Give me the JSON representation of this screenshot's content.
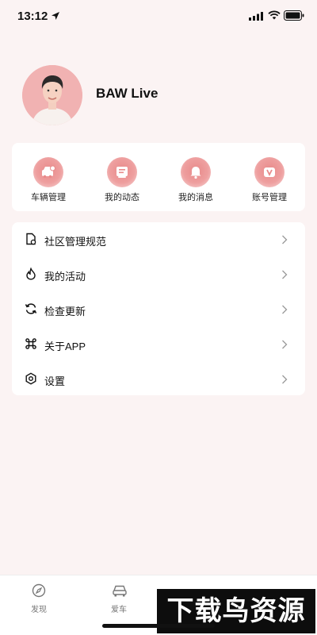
{
  "status_bar": {
    "time": "13:12"
  },
  "profile": {
    "username": "BAW Live"
  },
  "quick_actions": [
    {
      "label": "车辆管理",
      "icon": "car-manage-icon"
    },
    {
      "label": "我的动态",
      "icon": "feed-icon"
    },
    {
      "label": "我的消息",
      "icon": "bell-icon"
    },
    {
      "label": "账号管理",
      "icon": "account-icon"
    }
  ],
  "menu": [
    {
      "label": "社区管理规范",
      "icon": "document-icon"
    },
    {
      "label": "我的活动",
      "icon": "flame-icon"
    },
    {
      "label": "检查更新",
      "icon": "refresh-icon"
    },
    {
      "label": "关于APP",
      "icon": "command-icon"
    },
    {
      "label": "设置",
      "icon": "settings-icon"
    }
  ],
  "tabs": [
    {
      "label": "发现",
      "icon": "compass-icon"
    },
    {
      "label": "爱车",
      "icon": "car-icon"
    }
  ],
  "watermark": "下载鸟资源",
  "colors": {
    "accent": "#ec9595",
    "background": "#fbf3f3",
    "card": "#ffffff"
  }
}
